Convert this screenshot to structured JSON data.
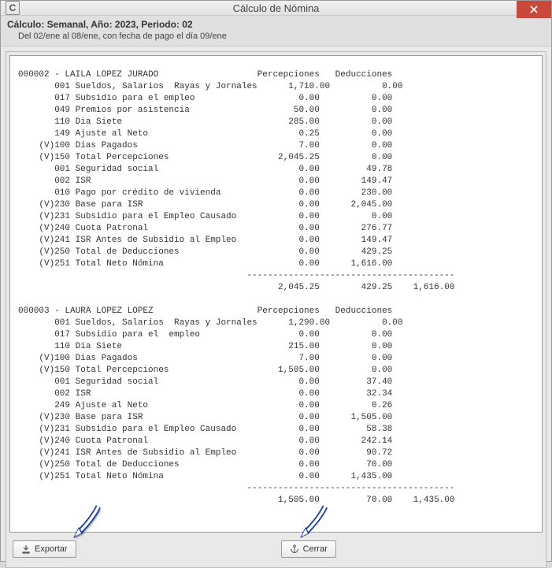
{
  "window": {
    "title": "Cálculo de Nómina",
    "icon_letter": "C"
  },
  "subheader": {
    "line1": "Cálculo: Semanal, Año: 2023, Periodo: 02",
    "line2": "Del 02/ene al 08/ene, con fecha de pago el día 09/ene"
  },
  "col_headers": {
    "percep": "Percepciones",
    "deduc": "Deducciones"
  },
  "employees": [
    {
      "id": "000002",
      "name": "LAILA LOPEZ JURADO",
      "rows": [
        {
          "v": "",
          "code": "001",
          "label": "Sueldos, Salarios  Rayas y Jornales",
          "c1": "1,710.00",
          "c2": "0.00"
        },
        {
          "v": "",
          "code": "017",
          "label": "Subsidio para el empleo",
          "c1": "0.00",
          "c2": "0.00"
        },
        {
          "v": "",
          "code": "049",
          "label": "Premios por asistencia",
          "c1": "50.00",
          "c2": "0.00"
        },
        {
          "v": "",
          "code": "110",
          "label": "Dia Siete",
          "c1": "285.00",
          "c2": "0.00"
        },
        {
          "v": "",
          "code": "149",
          "label": "Ajuste al Neto",
          "c1": "0.25",
          "c2": "0.00"
        },
        {
          "v": "(V)",
          "code": "100",
          "label": "Dias Pagados",
          "c1": "7.00",
          "c2": "0.00"
        },
        {
          "v": "(V)",
          "code": "150",
          "label": "Total Percepciones",
          "c1": "2,045.25",
          "c2": "0.00"
        },
        {
          "v": "",
          "code": "001",
          "label": "Seguridad social",
          "c1": "0.00",
          "c2": "49.78"
        },
        {
          "v": "",
          "code": "002",
          "label": "ISR",
          "c1": "0.00",
          "c2": "149.47"
        },
        {
          "v": "",
          "code": "010",
          "label": "Pago por crédito de vivienda",
          "c1": "0.00",
          "c2": "230.00"
        },
        {
          "v": "(V)",
          "code": "230",
          "label": "Base para ISR",
          "c1": "0.00",
          "c2": "2,045.00"
        },
        {
          "v": "(V)",
          "code": "231",
          "label": "Subsidio para el Empleo Causado",
          "c1": "0.00",
          "c2": "0.00"
        },
        {
          "v": "(V)",
          "code": "240",
          "label": "Cuota Patronal",
          "c1": "0.00",
          "c2": "276.77"
        },
        {
          "v": "(V)",
          "code": "241",
          "label": "ISR Antes de Subsidio al Empleo",
          "c1": "0.00",
          "c2": "149.47"
        },
        {
          "v": "(V)",
          "code": "250",
          "label": "Total de Deducciones",
          "c1": "0.00",
          "c2": "429.25"
        },
        {
          "v": "(V)",
          "code": "251",
          "label": "Total Neto Nómina",
          "c1": "0.00",
          "c2": "1,616.00"
        }
      ],
      "totals": {
        "c1": "2,045.25",
        "c2": "429.25",
        "c3": "1,616.00"
      }
    },
    {
      "id": "000003",
      "name": "LAURA LOPEZ LOPEZ",
      "rows": [
        {
          "v": "",
          "code": "001",
          "label": "Sueldos, Salarios  Rayas y Jornales",
          "c1": "1,290.00",
          "c2": "0.00"
        },
        {
          "v": "",
          "code": "017",
          "label": "Subsidio para el  empleo",
          "c1": "0.00",
          "c2": "0.00"
        },
        {
          "v": "",
          "code": "110",
          "label": "Dia Siete",
          "c1": "215.00",
          "c2": "0.00"
        },
        {
          "v": "(V)",
          "code": "100",
          "label": "Dias Pagados",
          "c1": "7.00",
          "c2": "0.00"
        },
        {
          "v": "(V)",
          "code": "150",
          "label": "Total Percepciones",
          "c1": "1,505.00",
          "c2": "0.00"
        },
        {
          "v": "",
          "code": "001",
          "label": "Seguridad social",
          "c1": "0.00",
          "c2": "37.40"
        },
        {
          "v": "",
          "code": "002",
          "label": "ISR",
          "c1": "0.00",
          "c2": "32.34"
        },
        {
          "v": "",
          "code": "249",
          "label": "Ajuste al Neto",
          "c1": "0.00",
          "c2": "0.26"
        },
        {
          "v": "(V)",
          "code": "230",
          "label": "Base para ISR",
          "c1": "0.00",
          "c2": "1,505.00"
        },
        {
          "v": "(V)",
          "code": "231",
          "label": "Subsidio para el Empleo Causado",
          "c1": "0.00",
          "c2": "58.38"
        },
        {
          "v": "(V)",
          "code": "240",
          "label": "Cuota Patronal",
          "c1": "0.00",
          "c2": "242.14"
        },
        {
          "v": "(V)",
          "code": "241",
          "label": "ISR Antes de Subsidio al Empleo",
          "c1": "0.00",
          "c2": "90.72"
        },
        {
          "v": "(V)",
          "code": "250",
          "label": "Total de Deducciones",
          "c1": "0.00",
          "c2": "70.00"
        },
        {
          "v": "(V)",
          "code": "251",
          "label": "Total Neto Nómina",
          "c1": "0.00",
          "c2": "1,435.00"
        }
      ],
      "totals": {
        "c1": "1,505.00",
        "c2": "70.00",
        "c3": "1,435.00"
      }
    }
  ],
  "buttons": {
    "export": "Exportar",
    "close": "Cerrar"
  }
}
